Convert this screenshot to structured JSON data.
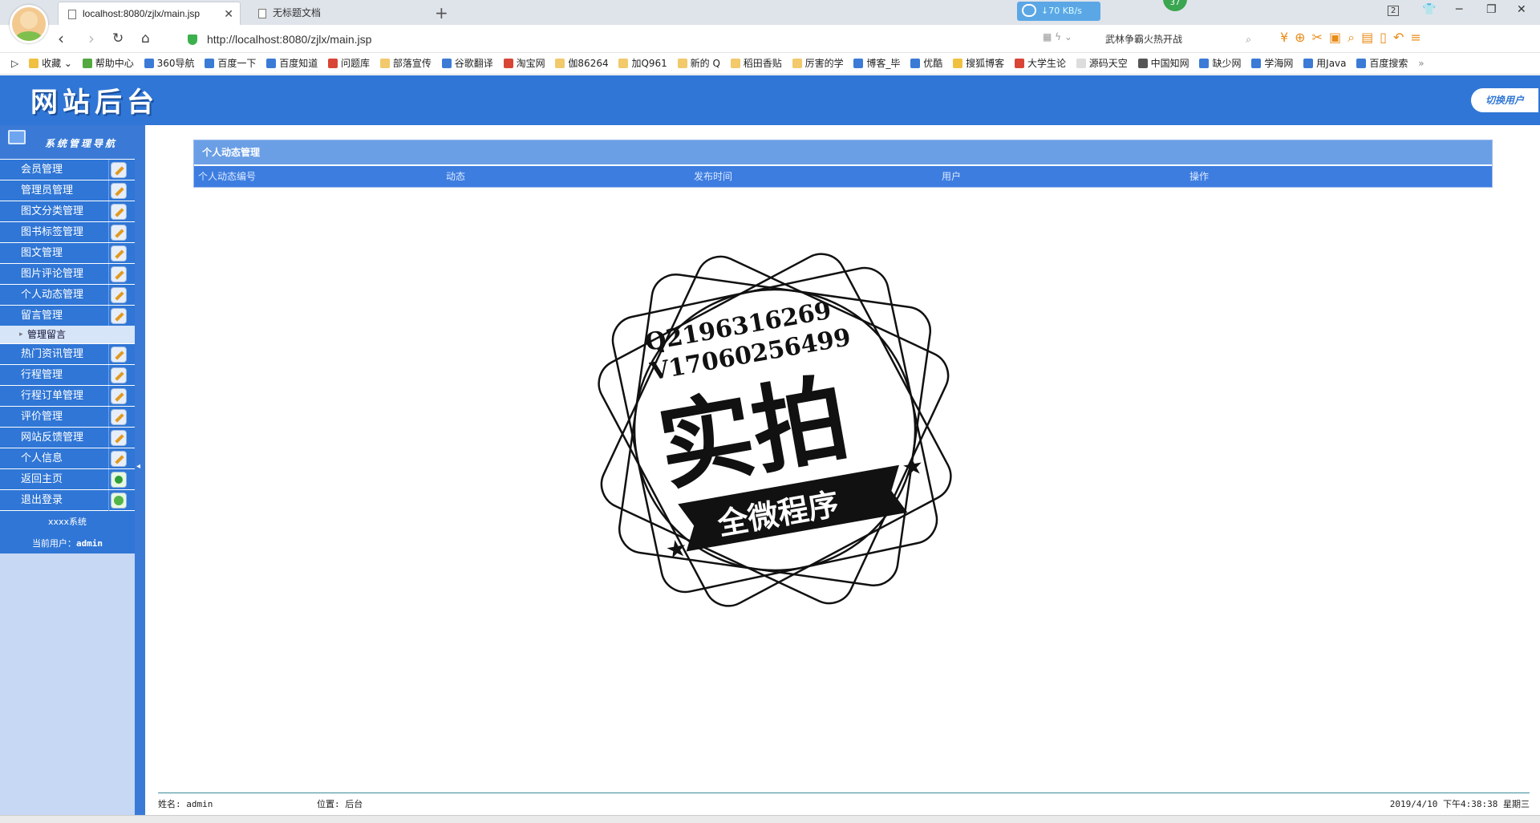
{
  "browser": {
    "tabs": [
      {
        "label": "localhost:8080/zjlx/main.jsp",
        "active": true
      },
      {
        "label": "无标题文档",
        "active": false
      }
    ],
    "download_speed": "↓70 KB/s",
    "notify_count": "37",
    "window_counter": "2",
    "url": "http://localhost:8080/zjlx/main.jsp",
    "search_text": "武林争霸火热开战",
    "bookmarks": [
      {
        "label": "收藏",
        "icon": "star-icon"
      },
      {
        "label": "帮助中心",
        "icon": "help-icon"
      },
      {
        "label": "360导航",
        "icon": "paw-icon"
      },
      {
        "label": "百度一下",
        "icon": "paw-icon"
      },
      {
        "label": "百度知道",
        "icon": "paw-icon"
      },
      {
        "label": "问题库",
        "icon": "s-icon"
      },
      {
        "label": "部落宣传",
        "icon": "folder-icon"
      },
      {
        "label": "谷歌翻译",
        "icon": "translate-icon"
      },
      {
        "label": "淘宝网",
        "icon": "taobao-icon"
      },
      {
        "label": "伽86264",
        "icon": "folder-icon"
      },
      {
        "label": "加Q961",
        "icon": "folder-icon"
      },
      {
        "label": "新的 Q",
        "icon": "folder-icon"
      },
      {
        "label": "稻田香贴",
        "icon": "folder-icon"
      },
      {
        "label": "厉害的学",
        "icon": "folder-icon"
      },
      {
        "label": "博客_毕",
        "icon": "blog-icon"
      },
      {
        "label": "优酷",
        "icon": "play-icon"
      },
      {
        "label": "搜狐博客",
        "icon": "fox-icon"
      },
      {
        "label": "大学生论",
        "icon": "user-icon"
      },
      {
        "label": "源码天空",
        "icon": "doc-icon"
      },
      {
        "label": "中国知网",
        "icon": "cnki-icon"
      },
      {
        "label": "缺少网",
        "icon": "d-icon"
      },
      {
        "label": "学海网",
        "icon": "sail-icon"
      },
      {
        "label": "用Java",
        "icon": "j-icon"
      },
      {
        "label": "百度搜索",
        "icon": "paw-icon"
      }
    ]
  },
  "header": {
    "logo": "网站后台",
    "switch_user": "切换用户"
  },
  "sidebar": {
    "title": "系统管理导航",
    "items": [
      {
        "label": "会员管理"
      },
      {
        "label": "管理员管理"
      },
      {
        "label": "图文分类管理"
      },
      {
        "label": "图书标签管理"
      },
      {
        "label": "图文管理"
      },
      {
        "label": "图片评论管理"
      },
      {
        "label": "个人动态管理"
      },
      {
        "label": "留言管理"
      }
    ],
    "subitem": "管理留言",
    "items2": [
      {
        "label": "热门资讯管理"
      },
      {
        "label": "行程管理"
      },
      {
        "label": "行程订单管理"
      },
      {
        "label": "评价管理"
      },
      {
        "label": "网站反馈管理"
      },
      {
        "label": "个人信息"
      },
      {
        "label": "返回主页"
      },
      {
        "label": "退出登录"
      }
    ],
    "system_name": "xxxx系统",
    "current_user_label": "当前用户：",
    "current_user": "admin"
  },
  "panel": {
    "title": "个人动态管理",
    "columns": [
      "个人动态编号",
      "动态",
      "发布时间",
      "用户",
      "操作"
    ]
  },
  "watermark": {
    "line1": "Q2196316269",
    "line2": "V17060256499",
    "big": "实拍",
    "ribbon": "全微程序"
  },
  "status": {
    "name_label": "姓名: admin",
    "location_label": "位置: 后台",
    "datetime": "2019/4/10 下午4:38:38 星期三"
  }
}
